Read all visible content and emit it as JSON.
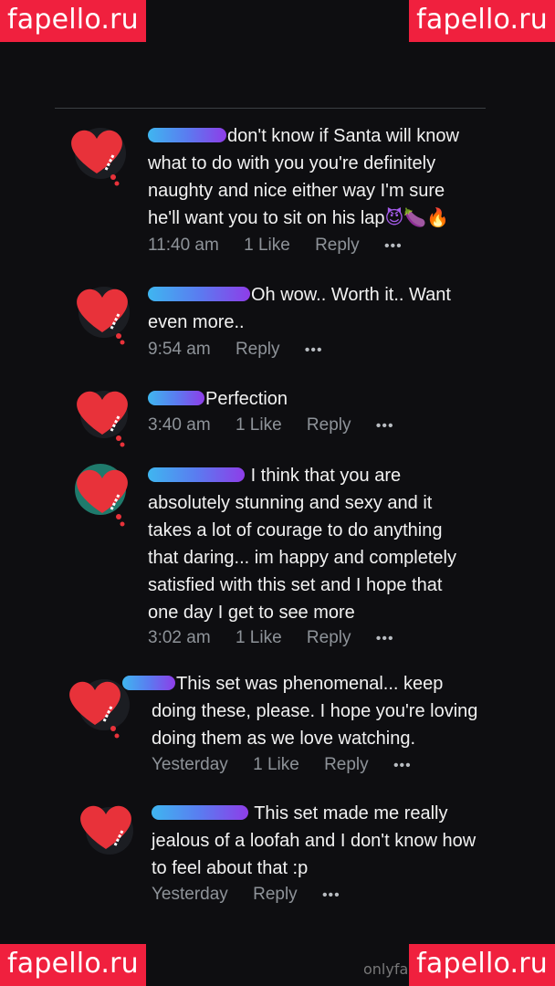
{
  "watermarks": {
    "top_left": "fapello.ru",
    "top_right": "fapello.ru",
    "bottom_left": "fapello.ru",
    "bottom_right": "fapello.ru"
  },
  "footer_text": "onlyfa",
  "comments": [
    {
      "text": "don't know if Santa will know what to do with you you're definitely naughty and nice either way I'm sure he'll want you to sit on his lap",
      "emojis": [
        "😈",
        "🍆",
        "🔥"
      ],
      "time": "11:40 am",
      "likes": "1 Like",
      "reply": "Reply",
      "more": "•••"
    },
    {
      "text": "Oh wow.. Worth it.. Want even more..",
      "time": "9:54 am",
      "reply": "Reply",
      "more": "•••"
    },
    {
      "text": "Perfection",
      "time": "3:40 am",
      "likes": "1 Like",
      "reply": "Reply",
      "more": "•••"
    },
    {
      "text": "I think that you are absolutely stunning and sexy and it takes a lot of courage to do anything that daring... im happy and completely satisfied with this set and I hope that one day I get to see more",
      "time": "3:02 am",
      "likes": "1 Like",
      "reply": "Reply",
      "more": "•••"
    },
    {
      "text": "This set was phenomenal... keep doing these, please. I hope you're loving doing them as we love watching.",
      "time": "Yesterday",
      "likes": "1 Like",
      "reply": "Reply",
      "more": "•••"
    },
    {
      "text": "This set made me really jealous of a loofah and I don't know how to feel about that :p",
      "time": "Yesterday",
      "reply": "Reply",
      "more": "•••"
    }
  ],
  "colors": {
    "background": "#0e0e11",
    "watermark": "#f0203e",
    "heart": "#e8323a",
    "name_gradient_start": "#3fb6f0",
    "name_gradient_end": "#8e3de8",
    "meta": "#8e9399"
  },
  "icons": [
    "heart-avatar-icon",
    "more-dots-icon"
  ]
}
